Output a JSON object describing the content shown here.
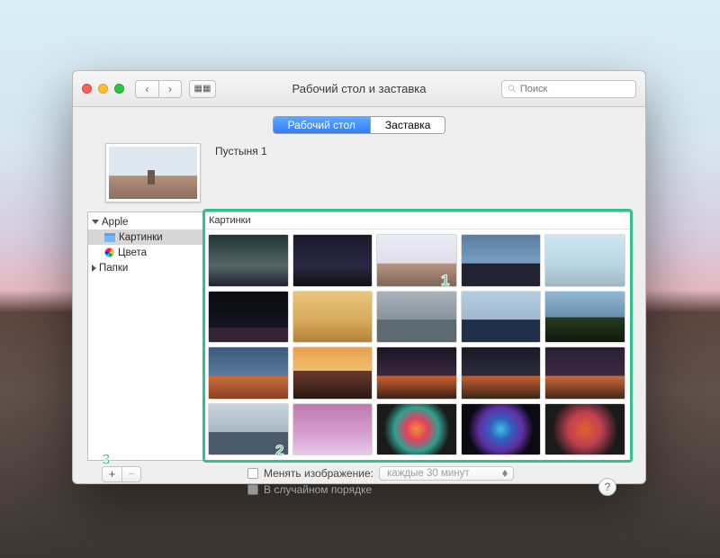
{
  "window": {
    "title": "Рабочий стол и заставка"
  },
  "search": {
    "placeholder": "Поиск"
  },
  "tabs": {
    "desktop": "Рабочий стол",
    "screensaver": "Заставка"
  },
  "current": {
    "name": "Пустыня 1"
  },
  "sidebar": {
    "apple": "Apple",
    "pictures": "Картинки",
    "colors": "Цвета",
    "folders": "Папки"
  },
  "thumbs": {
    "header": "Картинки"
  },
  "options": {
    "change_label": "Менять изображение:",
    "change_dropdown": "каждые 30 минут",
    "random_label": "В случайном порядке"
  },
  "buttons": {
    "add": "+",
    "remove": "−",
    "help": "?"
  },
  "annotations": {
    "one": "1",
    "two": "2",
    "three": "3"
  }
}
